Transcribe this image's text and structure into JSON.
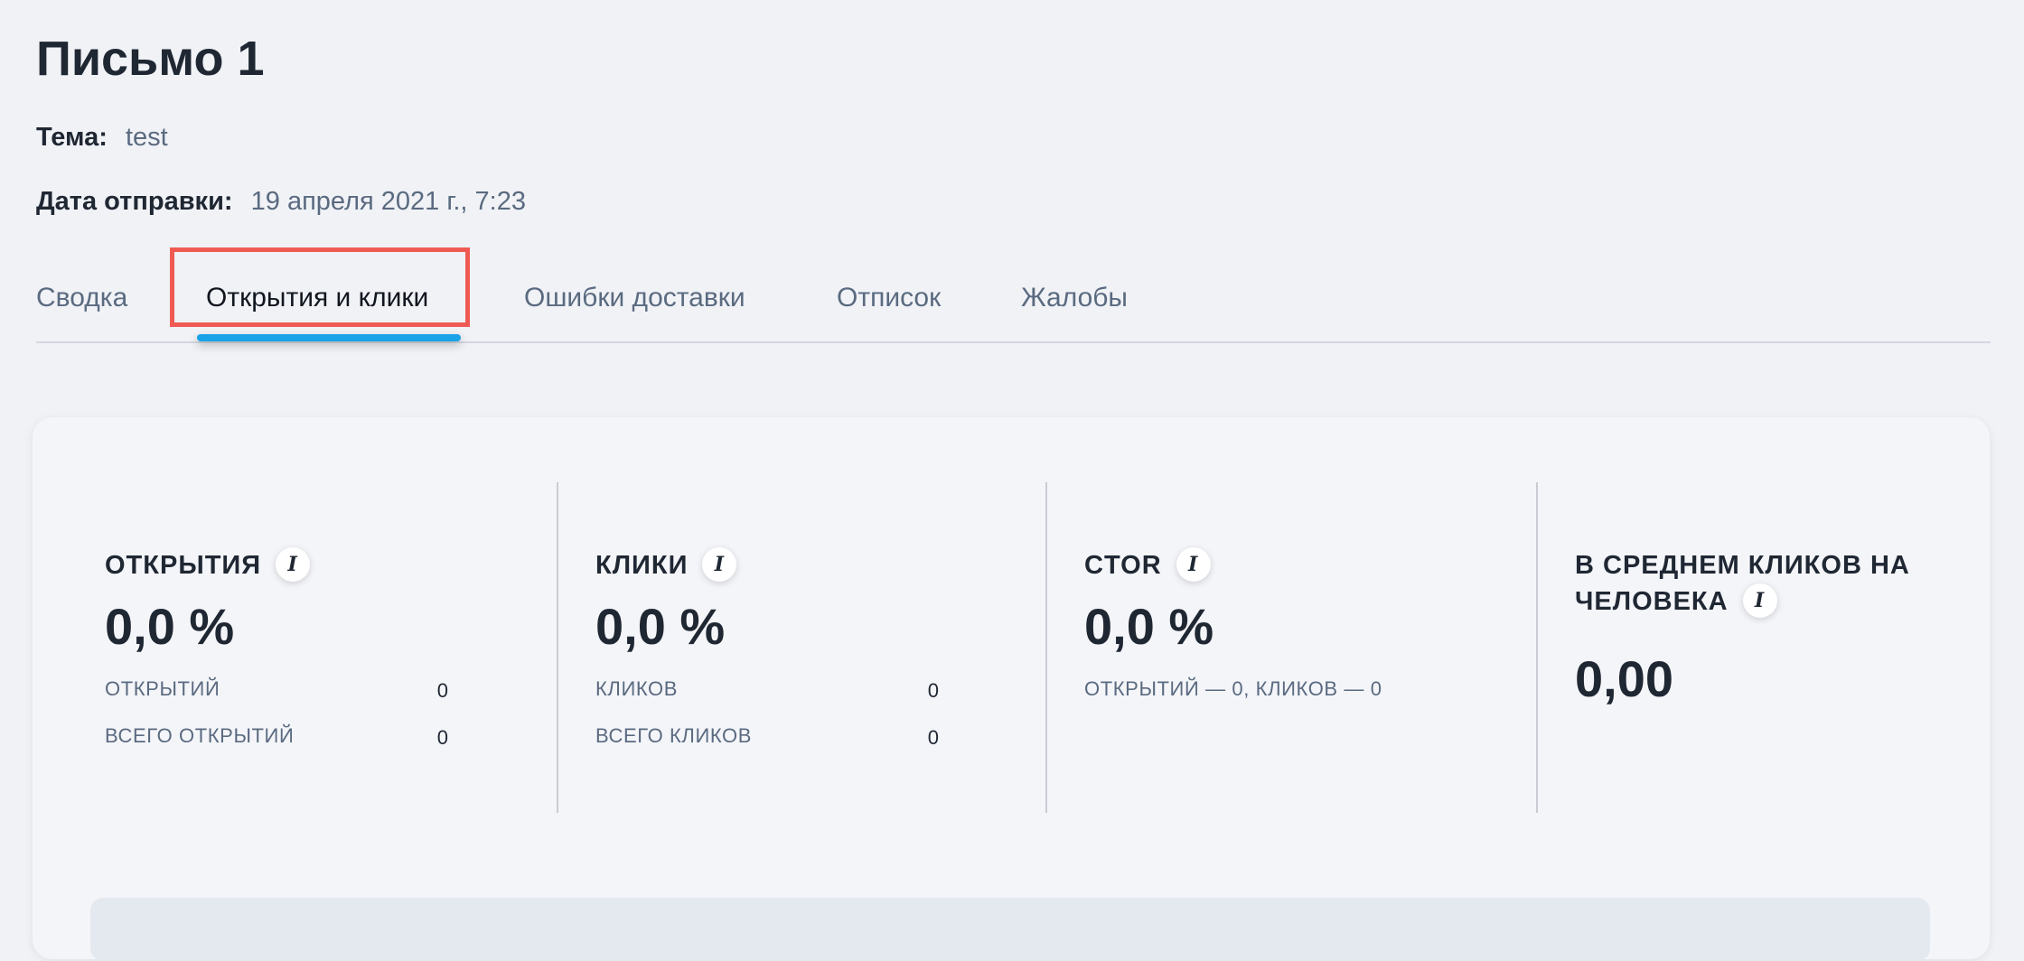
{
  "header": {
    "title": "Письмо 1",
    "subject_label": "Тема:",
    "subject_value": "test",
    "date_label": "Дата отправки:",
    "date_value": "19 апреля 2021 г., 7:23"
  },
  "tabs": [
    {
      "label": "Сводка",
      "active": false
    },
    {
      "label": "Открытия и клики",
      "active": true
    },
    {
      "label": "Ошибки доставки",
      "active": false
    },
    {
      "label": "Отписок",
      "active": false
    },
    {
      "label": "Жалобы",
      "active": false
    }
  ],
  "stats": {
    "opens": {
      "title": "ОТКРЫТИЯ",
      "info_icon": "i",
      "value": "0,0 %",
      "rows": [
        {
          "label": "ОТКРЫТИЙ",
          "value": "0"
        },
        {
          "label": "ВСЕГО ОТКРЫТИЙ",
          "value": "0"
        }
      ]
    },
    "clicks": {
      "title": "КЛИКИ",
      "info_icon": "i",
      "value": "0,0 %",
      "rows": [
        {
          "label": "КЛИКОВ",
          "value": "0"
        },
        {
          "label": "ВСЕГО КЛИКОВ",
          "value": "0"
        }
      ]
    },
    "ctor": {
      "title": "CTOR",
      "info_icon": "i",
      "value": "0,0 %",
      "summary": "ОТКРЫТИЙ — 0, КЛИКОВ — 0"
    },
    "average": {
      "title": "В СРЕДНЕМ КЛИКОВ НА ЧЕЛОВЕКА",
      "info_icon": "i",
      "value": "0,00"
    }
  },
  "colors": {
    "background": "#f0f2f6",
    "card": "#f4f5f9",
    "active_tab_underline": "#1aa2e8",
    "highlight_box": "#ef5b53",
    "muted_text": "#5a6a80",
    "primary_text": "#1f2733"
  },
  "icons": {
    "info": "info-icon"
  }
}
